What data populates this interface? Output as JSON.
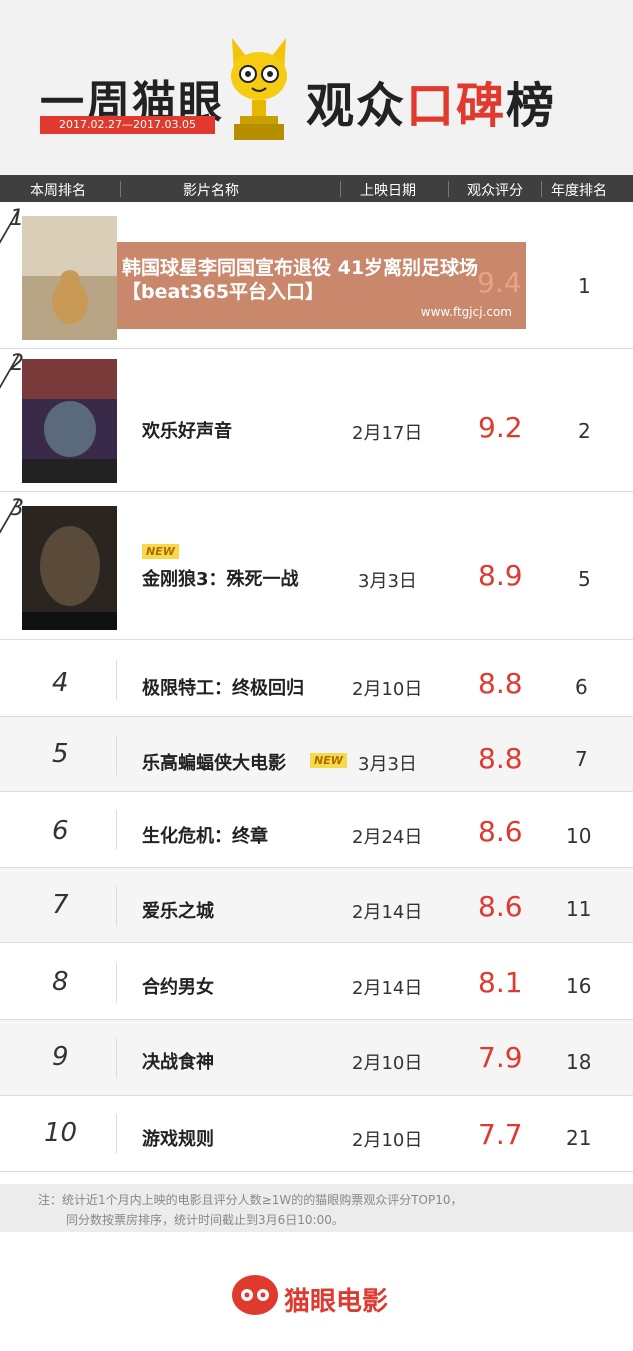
{
  "header": {
    "title_left": "一周猫眼",
    "date_range": "2017.02.27—2017.03.05",
    "title_right_black": "观众",
    "title_right_red": "口碑",
    "title_right_tail": "榜",
    "accent": "#e03a2f"
  },
  "columns": [
    "本周排名",
    "影片名称",
    "上映日期",
    "观众评分",
    "年度排名"
  ],
  "rows": [
    {
      "rank": "1",
      "name": "",
      "date": "",
      "score": "9.4",
      "year": "1"
    },
    {
      "rank": "2",
      "name": "欢乐好声音",
      "date": "2月17日",
      "score": "9.2",
      "year": "2"
    },
    {
      "rank": "3",
      "name": "金刚狼3：殊死一战",
      "date": "3月3日",
      "score": "8.9",
      "year": "5",
      "tag": "NEW"
    },
    {
      "rank": "4",
      "name": "极限特工：终极回归",
      "date": "2月10日",
      "score": "8.8",
      "year": "6"
    },
    {
      "rank": "5",
      "name": "乐高蝙蝠侠大电影",
      "date": "3月3日",
      "score": "8.8",
      "year": "7",
      "tag": "NEW"
    },
    {
      "rank": "6",
      "name": "生化危机：终章",
      "date": "2月24日",
      "score": "8.6",
      "year": "10"
    },
    {
      "rank": "7",
      "name": "爱乐之城",
      "date": "2月14日",
      "score": "8.6",
      "year": "11"
    },
    {
      "rank": "8",
      "name": "合约男女",
      "date": "2月14日",
      "score": "8.1",
      "year": "16"
    },
    {
      "rank": "9",
      "name": "决战食神",
      "date": "2月10日",
      "score": "7.9",
      "year": "18"
    },
    {
      "rank": "10",
      "name": "游戏规则",
      "date": "2月10日",
      "score": "7.7",
      "year": "21"
    }
  ],
  "overlay": {
    "headline": "韩国球星李同国宣布退役 41岁离别足球场【beat365平台入口】",
    "url": "www.ftgjcj.com"
  },
  "note": {
    "line1": "注：统计近1个月内上映的电影且评分人数≥1W的的猫眼购票观众评分TOP10，",
    "line2": "同分数按票房排序，统计时间截止到3月6日10:00。"
  },
  "footer": {
    "brand": "猫眼电影"
  }
}
